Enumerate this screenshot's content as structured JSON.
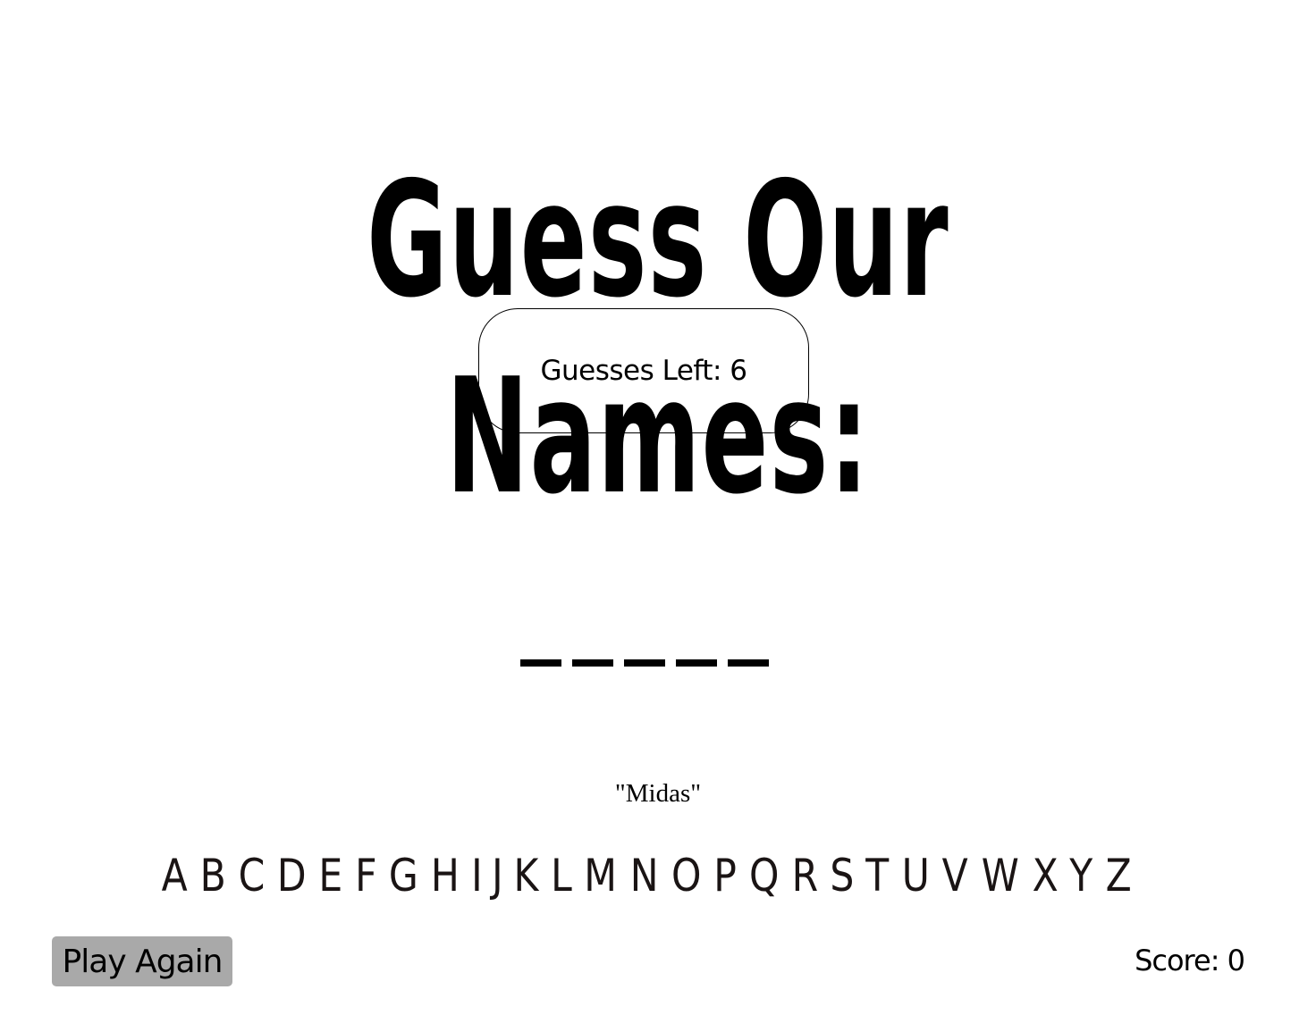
{
  "title": "Guess Our Names:",
  "guesses": {
    "label": "Guesses Left:",
    "value": "6",
    "text": "Guesses Left: 6"
  },
  "word": {
    "blank_count": 5
  },
  "hint": "\"Midas\"",
  "letters": [
    "A",
    "B",
    "C",
    "D",
    "E",
    "F",
    "G",
    "H",
    "I",
    "J",
    "K",
    "L",
    "M",
    "N",
    "O",
    "P",
    "Q",
    "R",
    "S",
    "T",
    "U",
    "V",
    "W",
    "X",
    "Y",
    "Z"
  ],
  "play_again_label": "Play Again",
  "score": {
    "label": "Score:",
    "value": "0",
    "text": "Score: 0"
  }
}
